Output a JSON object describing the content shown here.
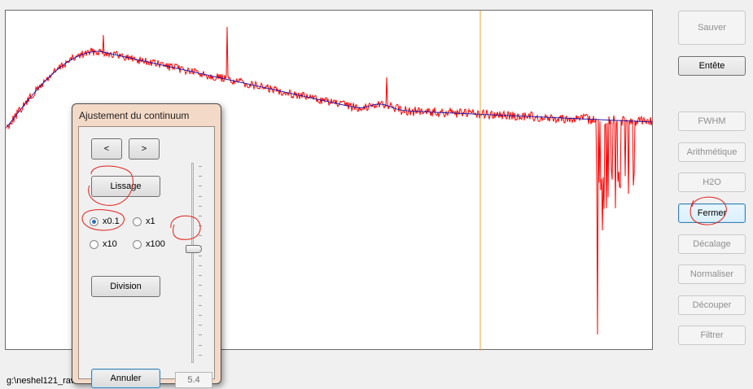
{
  "status_bar": {
    "file_path": "g:\\neshel121_raw-1.dat"
  },
  "right_panel": {
    "buttons": [
      {
        "label": "Sauver",
        "enabled": false
      },
      {
        "label": "Entête",
        "enabled": true
      },
      {
        "label": "FWHM",
        "enabled": false
      },
      {
        "label": "Arithmétique",
        "enabled": false
      },
      {
        "label": "H2O",
        "enabled": false
      },
      {
        "label": "Fermer",
        "enabled": true
      },
      {
        "label": "Décalage",
        "enabled": false
      },
      {
        "label": "Normaliser",
        "enabled": false
      },
      {
        "label": "Découper",
        "enabled": false
      },
      {
        "label": "Filtrer",
        "enabled": false
      }
    ]
  },
  "dialog": {
    "title": "Ajustement du continuum",
    "prev_label": "<",
    "next_label": ">",
    "smooth_label": "Lissage",
    "radios": [
      {
        "label": "x0.1",
        "checked": true
      },
      {
        "label": "x1",
        "checked": false
      },
      {
        "label": "x10",
        "checked": false
      },
      {
        "label": "x100",
        "checked": false
      }
    ],
    "divide_label": "Division",
    "cancel_label": "Annuler",
    "value": "5.4",
    "slider_level": 0.45
  },
  "colors": {
    "spectrum": "#ff0000",
    "continuum": "#1a1aa8",
    "cursor_line": "#e8a33a",
    "annotation": "#e0201a"
  }
}
